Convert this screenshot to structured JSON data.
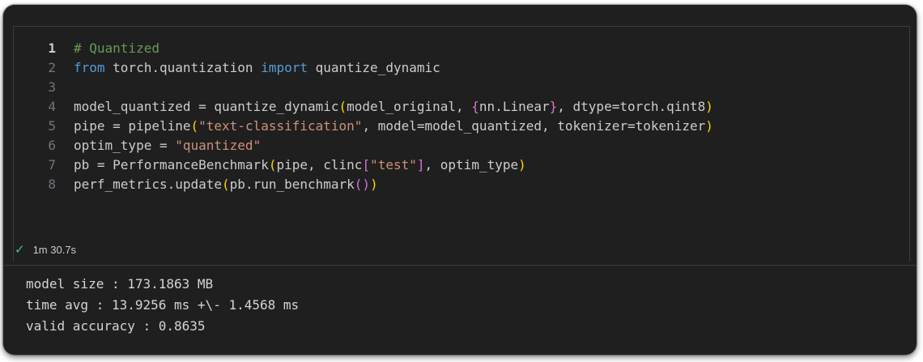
{
  "cell": {
    "lines": [
      {
        "num": "1",
        "parts": [
          {
            "t": "# Quantized",
            "c": "t-cmt"
          }
        ]
      },
      {
        "num": "2",
        "parts": [
          {
            "t": "from",
            "c": "t-kw"
          },
          {
            "t": " torch.quantization ",
            "c": ""
          },
          {
            "t": "import",
            "c": "t-kw"
          },
          {
            "t": " quantize_dynamic",
            "c": ""
          }
        ]
      },
      {
        "num": "3",
        "parts": []
      },
      {
        "num": "4",
        "parts": [
          {
            "t": "model_quantized = quantize_dynamic",
            "c": ""
          },
          {
            "t": "(",
            "c": "t-br1"
          },
          {
            "t": "model_original, ",
            "c": ""
          },
          {
            "t": "{",
            "c": "t-br2"
          },
          {
            "t": "nn.Linear",
            "c": ""
          },
          {
            "t": "}",
            "c": "t-br2"
          },
          {
            "t": ", dtype=torch.qint8",
            "c": ""
          },
          {
            "t": ")",
            "c": "t-br1"
          }
        ]
      },
      {
        "num": "5",
        "parts": [
          {
            "t": "pipe = pipeline",
            "c": ""
          },
          {
            "t": "(",
            "c": "t-br1"
          },
          {
            "t": "\"text-classification\"",
            "c": "t-str"
          },
          {
            "t": ", model=model_quantized, tokenizer=tokenizer",
            "c": ""
          },
          {
            "t": ")",
            "c": "t-br1"
          }
        ]
      },
      {
        "num": "6",
        "parts": [
          {
            "t": "optim_type = ",
            "c": ""
          },
          {
            "t": "\"quantized\"",
            "c": "t-str"
          }
        ]
      },
      {
        "num": "7",
        "parts": [
          {
            "t": "pb = PerformanceBenchmark",
            "c": ""
          },
          {
            "t": "(",
            "c": "t-br1"
          },
          {
            "t": "pipe, clinc",
            "c": ""
          },
          {
            "t": "[",
            "c": "t-br2"
          },
          {
            "t": "\"test\"",
            "c": "t-str"
          },
          {
            "t": "]",
            "c": "t-br2"
          },
          {
            "t": ", optim_type",
            "c": ""
          },
          {
            "t": ")",
            "c": "t-br1"
          }
        ]
      },
      {
        "num": "8",
        "parts": [
          {
            "t": "perf_metrics.update",
            "c": ""
          },
          {
            "t": "(",
            "c": "t-br1"
          },
          {
            "t": "pb.run_benchmark",
            "c": ""
          },
          {
            "t": "()",
            "c": "t-br2"
          },
          {
            "t": ")",
            "c": "t-br1"
          }
        ]
      }
    ],
    "active_line": "1",
    "status": {
      "icon": "check-icon",
      "duration": "1m 30.7s",
      "color": "#4ec27a"
    }
  },
  "output": {
    "lines": [
      "model size : 173.1863 MB",
      "time avg : 13.9256 ms +\\- 1.4568 ms",
      "valid accuracy : 0.8635"
    ]
  }
}
